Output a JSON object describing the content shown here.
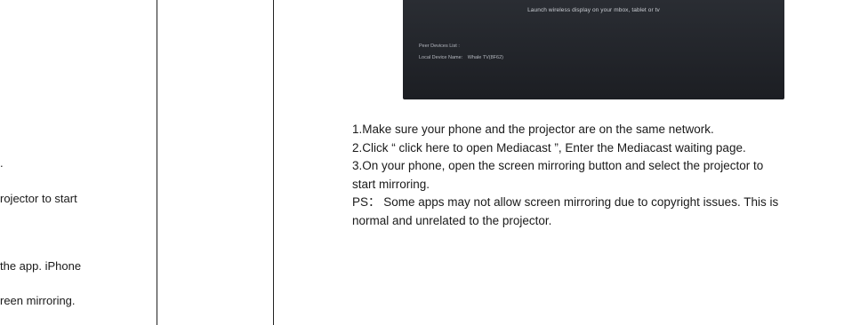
{
  "left_column": {
    "fragments": [
      ".",
      "rojector to start",
      " the app. iPhone",
      "reen mirroring."
    ]
  },
  "tv_screen": {
    "launch_text": "Launch wireless display on your mbox, tablet or tv",
    "peer_devices_label": "Peer Devices List :",
    "local_device_label": "Local Device Name:",
    "local_device_value": "Whale TV(8F62)"
  },
  "instructions": {
    "step1": "1.Make sure your phone and the projector are on the same network.",
    "step2": "2.Click “ click here to open Mediacast ”, Enter the Mediacast waiting page.",
    "step3_line1": "3.On your phone, open the screen mirroring button and select the projector to",
    "step3_line2": "start mirroring.",
    "ps_line1": "PS： Some apps may not allow screen mirroring due to copyright issues. This is",
    "ps_line2": "normal and unrelated to the projector."
  }
}
